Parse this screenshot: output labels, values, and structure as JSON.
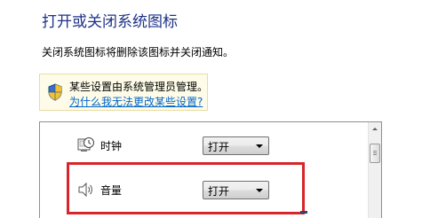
{
  "page": {
    "title": "打开或关闭系统图标",
    "description": "关闭系统图标将删除该图标并关闭通知。"
  },
  "info": {
    "icon": "shield-icon",
    "text": "某些设置由系统管理员管理。",
    "link": "为什么我无法更改某些设置?"
  },
  "icons": {
    "rows": [
      {
        "label": "时钟",
        "icon": "clock-icon",
        "value": "打开"
      },
      {
        "label": "音量",
        "icon": "speaker-icon",
        "value": "打开"
      }
    ]
  },
  "colors": {
    "title": "#1e3287",
    "link": "#0066cc",
    "info_background": "#fefce8",
    "highlight": "#d9252a"
  }
}
